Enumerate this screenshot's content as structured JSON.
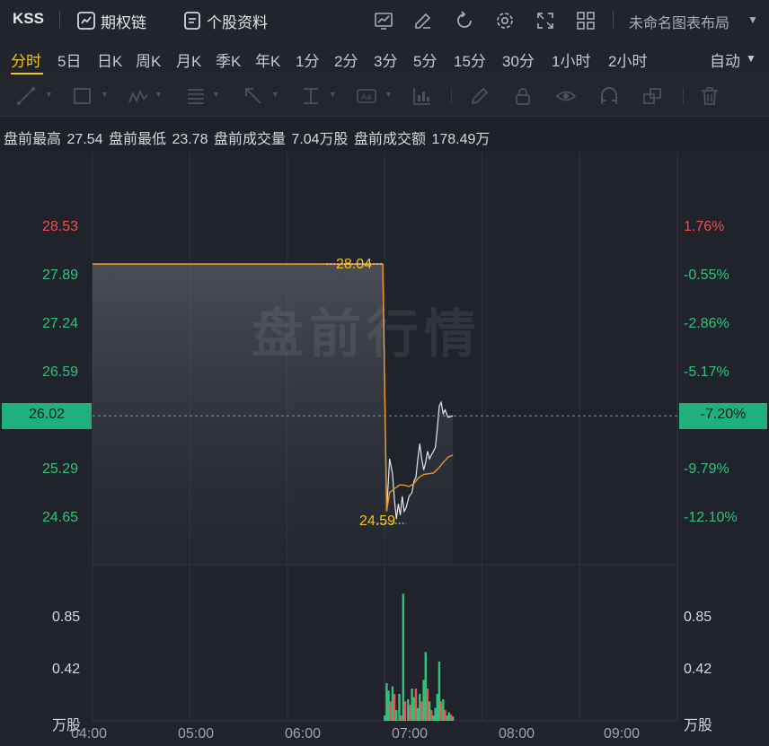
{
  "topbar": {
    "symbol": "KSS",
    "options_chain": "期权链",
    "stock_profile": "个股资料",
    "layout_name": "未命名图表布局"
  },
  "periods": [
    "分时",
    "5日",
    "日K",
    "周K",
    "月K",
    "季K",
    "年K",
    "1分",
    "2分",
    "3分",
    "5分",
    "15分",
    "30分",
    "1小时",
    "2小时"
  ],
  "period_active": "分时",
  "auto_mode": "自动",
  "info": {
    "high_label": "盘前最高",
    "high_value": "27.54",
    "low_label": "盘前最低",
    "low_value": "23.78",
    "vol_label": "盘前成交量",
    "vol_value": "7.04万股",
    "amount_label": "盘前成交额",
    "amount_value": "178.49万"
  },
  "watermark": "盘前行情",
  "colors": {
    "up": "#f0504f",
    "down": "#2ec27e",
    "avg_line": "#e8962c",
    "accent": "#f5c518"
  },
  "chart_data": {
    "type": "line",
    "y_left_ticks": [
      "28.53",
      "27.89",
      "27.24",
      "26.59",
      "26.02",
      "25.29",
      "24.65"
    ],
    "y_right_ticks": [
      "1.76%",
      "-0.55%",
      "-2.86%",
      "-5.17%",
      "-7.20%",
      "-9.79%",
      "-12.10%"
    ],
    "current_price": "26.02",
    "current_change": "-7.20%",
    "max_label": "28.04",
    "min_label": "24.59",
    "x_ticks": [
      "04:00",
      "05:00",
      "06:00",
      "07:00",
      "08:00",
      "09:00"
    ],
    "volume_ticks_left": [
      "0.85",
      "0.42",
      "万股"
    ],
    "volume_ticks_right": [
      "0.85",
      "0.42",
      "万股"
    ],
    "ylim": [
      24.2,
      28.9
    ],
    "price_series": [
      [
        4.0,
        28.04
      ],
      [
        6.98,
        28.04
      ],
      [
        7.02,
        24.75
      ],
      [
        7.05,
        25.45
      ],
      [
        7.08,
        25.25
      ],
      [
        7.1,
        24.9
      ],
      [
        7.12,
        24.65
      ],
      [
        7.14,
        24.85
      ],
      [
        7.16,
        24.7
      ],
      [
        7.18,
        24.95
      ],
      [
        7.2,
        24.75
      ],
      [
        7.22,
        24.8
      ],
      [
        7.25,
        24.95
      ],
      [
        7.28,
        25.0
      ],
      [
        7.3,
        25.15
      ],
      [
        7.32,
        25.2
      ],
      [
        7.34,
        25.45
      ],
      [
        7.36,
        25.65
      ],
      [
        7.38,
        25.45
      ],
      [
        7.4,
        25.3
      ],
      [
        7.42,
        25.4
      ],
      [
        7.44,
        25.55
      ],
      [
        7.46,
        25.45
      ],
      [
        7.48,
        25.5
      ],
      [
        7.5,
        25.55
      ],
      [
        7.52,
        25.6
      ],
      [
        7.54,
        25.85
      ],
      [
        7.56,
        26.15
      ],
      [
        7.58,
        26.2
      ],
      [
        7.6,
        26.05
      ],
      [
        7.62,
        26.1
      ],
      [
        7.65,
        26.0
      ],
      [
        7.7,
        26.02
      ]
    ],
    "avg_series": [
      [
        4.0,
        28.04
      ],
      [
        6.98,
        28.04
      ],
      [
        7.02,
        24.75
      ],
      [
        7.05,
        25.0
      ],
      [
        7.1,
        25.05
      ],
      [
        7.15,
        25.1
      ],
      [
        7.2,
        25.1
      ],
      [
        7.25,
        25.08
      ],
      [
        7.3,
        25.12
      ],
      [
        7.35,
        25.2
      ],
      [
        7.4,
        25.24
      ],
      [
        7.45,
        25.25
      ],
      [
        7.5,
        25.26
      ],
      [
        7.55,
        25.32
      ],
      [
        7.6,
        25.4
      ],
      [
        7.65,
        25.47
      ],
      [
        7.7,
        25.5
      ]
    ],
    "volume": [
      [
        7.0,
        0.05,
        "down"
      ],
      [
        7.02,
        0.35,
        "down"
      ],
      [
        7.04,
        0.28,
        "down"
      ],
      [
        7.06,
        0.18,
        "up"
      ],
      [
        7.08,
        0.32,
        "down"
      ],
      [
        7.1,
        0.25,
        "up"
      ],
      [
        7.12,
        0.1,
        "down"
      ],
      [
        7.15,
        0.25,
        "down"
      ],
      [
        7.17,
        0.05,
        "up"
      ],
      [
        7.19,
        1.18,
        "down"
      ],
      [
        7.21,
        0.18,
        "up"
      ],
      [
        7.24,
        0.2,
        "down"
      ],
      [
        7.26,
        0.15,
        "up"
      ],
      [
        7.28,
        0.3,
        "down"
      ],
      [
        7.3,
        0.22,
        "down"
      ],
      [
        7.32,
        0.3,
        "up"
      ],
      [
        7.34,
        0.12,
        "down"
      ],
      [
        7.36,
        0.25,
        "down"
      ],
      [
        7.38,
        0.18,
        "up"
      ],
      [
        7.4,
        0.38,
        "down"
      ],
      [
        7.42,
        0.64,
        "down"
      ],
      [
        7.44,
        0.3,
        "up"
      ],
      [
        7.46,
        0.18,
        "down"
      ],
      [
        7.48,
        0.1,
        "up"
      ],
      [
        7.5,
        0.05,
        "down"
      ],
      [
        7.52,
        0.12,
        "down"
      ],
      [
        7.54,
        0.25,
        "down"
      ],
      [
        7.56,
        0.55,
        "down"
      ],
      [
        7.58,
        0.18,
        "up"
      ],
      [
        7.6,
        0.2,
        "down"
      ],
      [
        7.62,
        0.1,
        "up"
      ],
      [
        7.64,
        0.05,
        "down"
      ],
      [
        7.66,
        0.08,
        "down"
      ],
      [
        7.68,
        0.06,
        "up"
      ],
      [
        7.7,
        0.04,
        "down"
      ]
    ]
  }
}
